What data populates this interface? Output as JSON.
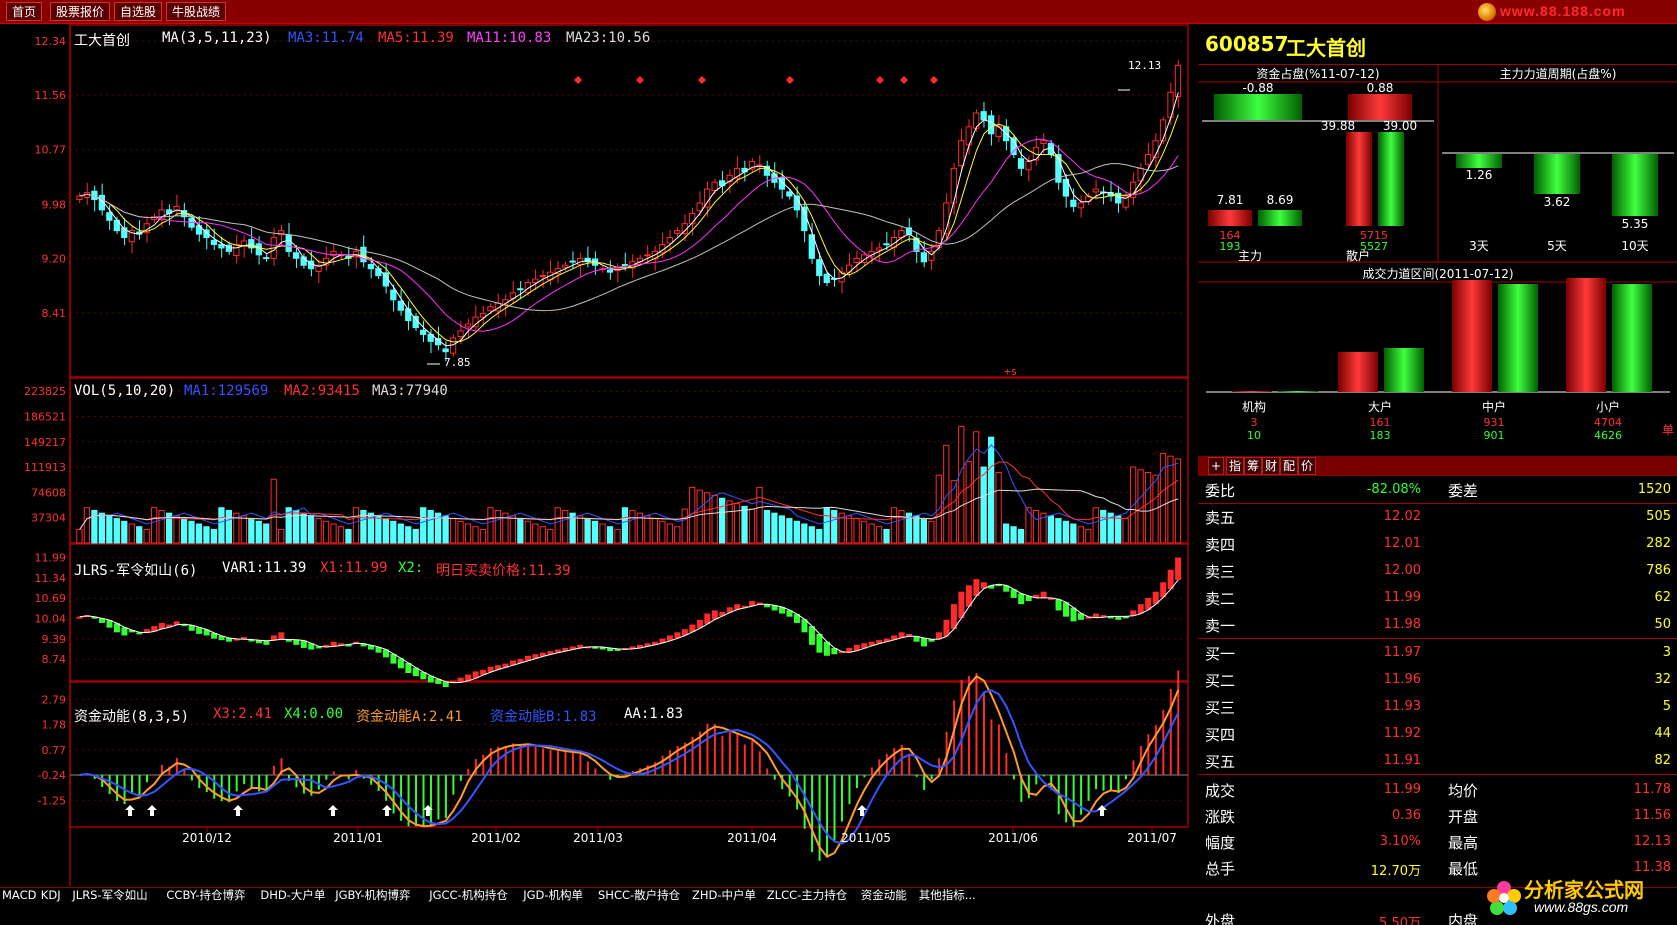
{
  "nav": {
    "home": "首页",
    "quote": "股票报价",
    "watch": "自选股",
    "record": "牛股战绩",
    "site": "www.88.188.com"
  },
  "stock": {
    "code": "600857",
    "name": "工大首创"
  },
  "colors": {
    "bg": "#000000",
    "up": "#ff2a2a",
    "down": "#54ffff",
    "frame": "#a00000",
    "ma1": "#ffffff",
    "ma2": "#ffff00",
    "ma3": "#ff30ff",
    "ma4": "#c0c0c0"
  },
  "panes": {
    "main": {
      "title": "工大首创",
      "ind": "MA(3,5,11,23)",
      "ma1": "MA3:11.74",
      "ma2": "MA5:11.39",
      "ma3": "MA11:10.83",
      "ma4": "MA23:10.56",
      "ticks": [
        "12.34",
        "11.56",
        "10.77",
        "9.98",
        "9.20",
        "8.41"
      ],
      "high": "12.13",
      "low": "7.85",
      "note": "+s"
    },
    "vol": {
      "ind": "VOL(5,10,20)",
      "ma1": "MA1:129569",
      "ma2": "MA2:93415",
      "ma3": "MA3:77940",
      "ticks": [
        "223825",
        "186521",
        "149217",
        "111913",
        "74608",
        "37304"
      ]
    },
    "jlrs": {
      "ind": "JLRS-军令如山(6)",
      "var1": "VAR1:11.39",
      "x1": "X1:11.99",
      "x2": "X2:",
      "x2t": "明日买卖价格:11.39",
      "ticks": [
        "11.99",
        "11.34",
        "10.69",
        "10.04",
        "9.39",
        "8.74"
      ]
    },
    "zjdn": {
      "ind": "资金动能(8,3,5)",
      "x3": "X3:2.41",
      "x4": "X4:0.00",
      "a": "资金动能A:2.41",
      "b": "资金动能B:1.83",
      "aa": "AA:1.83",
      "ticks": [
        "2.79",
        "1.78",
        "0.77",
        "-0.24",
        "-1.25"
      ]
    }
  },
  "dates": [
    "2010/12",
    "2011/01",
    "2011/02",
    "2011/03",
    "2011/04",
    "2011/05",
    "2011/06",
    "2011/07"
  ],
  "chart_data": {
    "type": "candlestick",
    "closes": [
      10.1,
      10.15,
      10.05,
      9.9,
      9.75,
      9.6,
      9.5,
      9.6,
      9.55,
      9.7,
      9.8,
      9.9,
      9.85,
      9.95,
      9.8,
      9.65,
      9.55,
      9.5,
      9.4,
      9.35,
      9.3,
      9.4,
      9.45,
      9.35,
      9.25,
      9.2,
      9.5,
      9.6,
      9.3,
      9.2,
      9.1,
      9.05,
      9.1,
      9.2,
      9.3,
      9.25,
      9.2,
      9.3,
      9.15,
      9.05,
      8.95,
      8.8,
      8.6,
      8.45,
      8.3,
      8.2,
      8.1,
      8.0,
      7.95,
      7.85,
      8.05,
      8.15,
      8.25,
      8.35,
      8.4,
      8.5,
      8.55,
      8.6,
      8.7,
      8.75,
      8.85,
      8.9,
      8.95,
      9.0,
      9.05,
      9.1,
      9.15,
      9.2,
      9.15,
      9.1,
      9.05,
      9.0,
      9.05,
      9.1,
      9.15,
      9.2,
      9.25,
      9.3,
      9.4,
      9.5,
      9.6,
      9.7,
      9.85,
      10.0,
      10.2,
      10.3,
      10.25,
      10.4,
      10.5,
      10.45,
      10.6,
      10.55,
      10.4,
      10.3,
      10.2,
      10.1,
      9.9,
      9.6,
      9.2,
      8.95,
      8.85,
      8.9,
      9.0,
      9.1,
      9.2,
      9.25,
      9.3,
      9.35,
      9.4,
      9.5,
      9.6,
      9.55,
      9.3,
      9.15,
      9.3,
      9.6,
      10.0,
      10.5,
      10.9,
      11.1,
      11.3,
      11.2,
      11.0,
      11.1,
      10.9,
      10.7,
      10.5,
      10.6,
      10.8,
      10.9,
      10.7,
      10.3,
      10.1,
      9.95,
      10.0,
      10.1,
      10.2,
      10.15,
      10.1,
      10.0,
      10.1,
      10.3,
      10.5,
      10.7,
      10.9,
      11.2,
      11.6,
      11.99
    ]
  }
}
